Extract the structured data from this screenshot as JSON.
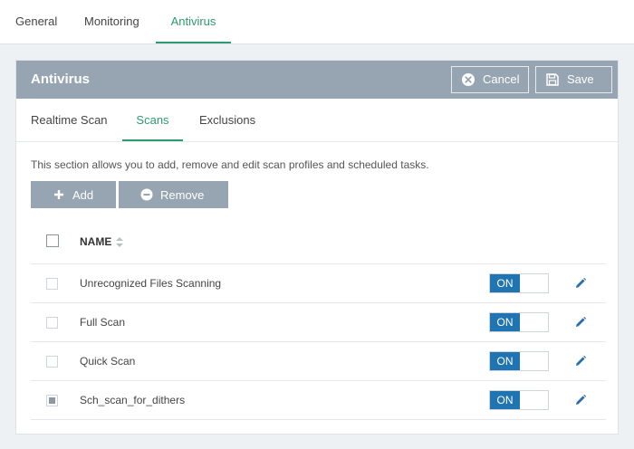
{
  "top_tabs": [
    {
      "label": "General"
    },
    {
      "label": "Monitoring"
    },
    {
      "label": "Antivirus"
    }
  ],
  "panel": {
    "title": "Antivirus",
    "cancel_label": "Cancel",
    "save_label": "Save"
  },
  "sub_tabs": [
    {
      "label": "Realtime Scan"
    },
    {
      "label": "Scans"
    },
    {
      "label": "Exclusions"
    }
  ],
  "description": "This section allows you to add, remove and edit scan profiles and scheduled tasks.",
  "actions": {
    "add_label": "Add",
    "remove_label": "Remove"
  },
  "table": {
    "name_header": "NAME",
    "rows": [
      {
        "name": "Unrecognized Files Scanning",
        "toggle": "ON",
        "checked": false
      },
      {
        "name": "Full Scan",
        "toggle": "ON",
        "checked": false
      },
      {
        "name": "Quick Scan",
        "toggle": "ON",
        "checked": false
      },
      {
        "name": "Sch_scan_for_dithers",
        "toggle": "ON",
        "checked": true
      }
    ]
  },
  "colors": {
    "accent_green": "#2e9a6f",
    "header_gray": "#97a5b2",
    "toggle_blue": "#1f74b1",
    "edit_blue": "#2a6db0"
  }
}
